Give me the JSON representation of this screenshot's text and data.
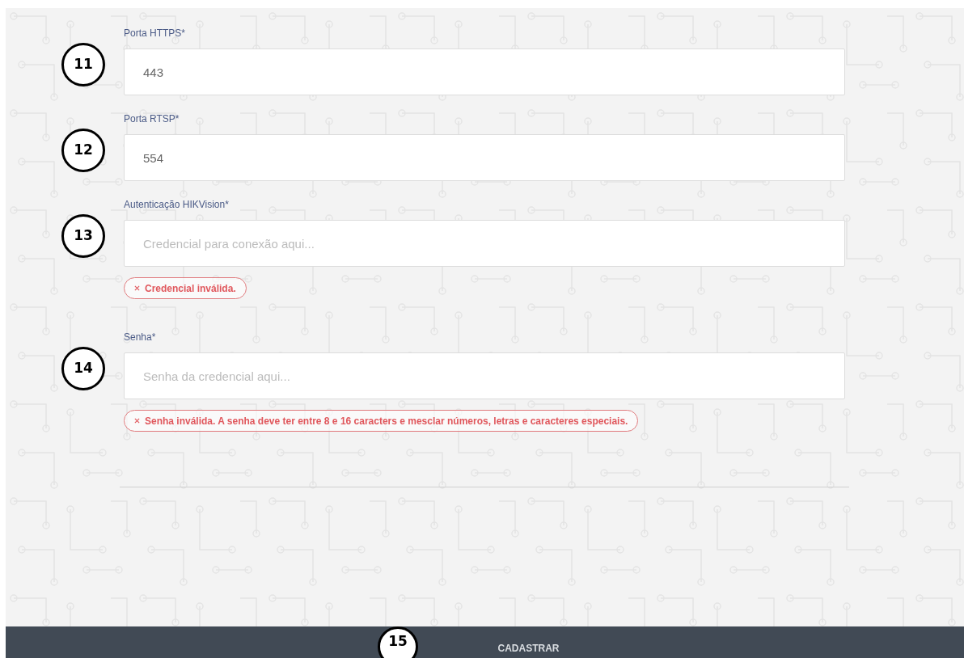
{
  "fields": [
    {
      "marker": "11",
      "label": "Porta HTTPS*",
      "value": "443"
    },
    {
      "marker": "12",
      "label": "Porta RTSP*",
      "value": "554"
    },
    {
      "marker": "13",
      "label": "Autenticação HIKVision*",
      "placeholder": "Credencial para conexão aqui...",
      "error": "Credencial inválida."
    },
    {
      "marker": "14",
      "label": "Senha*",
      "placeholder": "Senha da credencial aqui...",
      "error": "Senha inválida. A senha deve ter entre 8 e 16 caracters e mesclar números, letras e caracteres especiais."
    }
  ],
  "submit": {
    "marker": "15",
    "label": "CADASTRAR"
  }
}
